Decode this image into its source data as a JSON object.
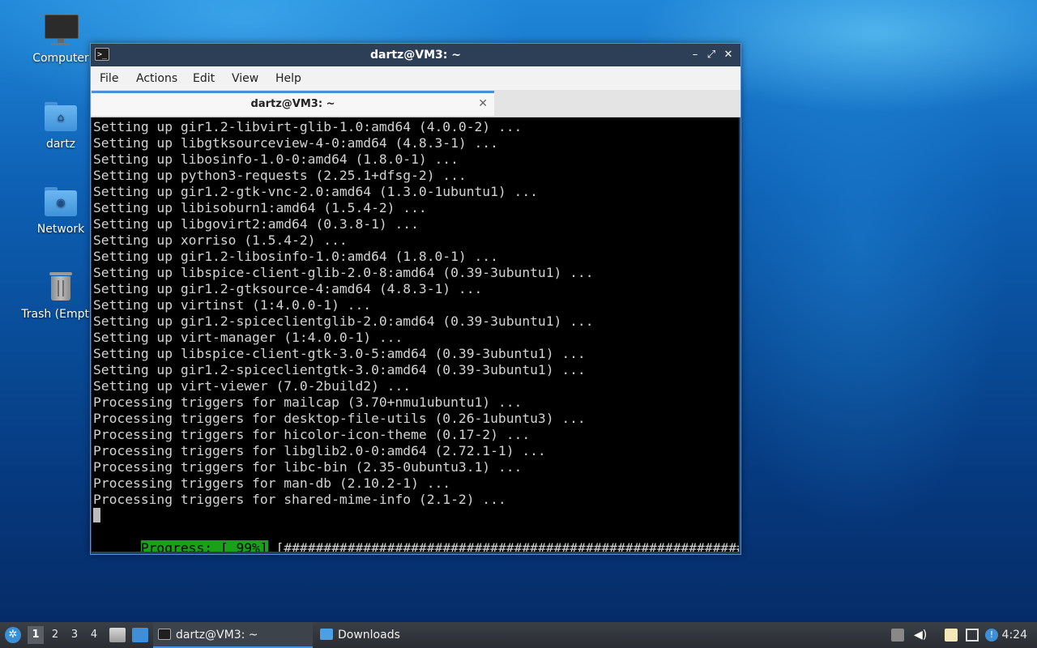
{
  "desktop": {
    "icons": [
      {
        "label": "Computer",
        "icon": "computer-icon"
      },
      {
        "label": "dartz",
        "icon": "home-folder-icon"
      },
      {
        "label": "Network",
        "icon": "network-folder-icon"
      },
      {
        "label": "Trash (Empty)",
        "icon": "trash-icon"
      }
    ]
  },
  "window": {
    "title": "dartz@VM3: ~",
    "controls": {
      "minimize": "–",
      "maximize": "⤢",
      "close": "✕"
    },
    "menu": [
      "File",
      "Actions",
      "Edit",
      "View",
      "Help"
    ],
    "tab": {
      "title": "dartz@VM3: ~",
      "close": "✕"
    }
  },
  "terminal": {
    "lines": [
      "Setting up gir1.2-libvirt-glib-1.0:amd64 (4.0.0-2) ...",
      "Setting up libgtksourceview-4-0:amd64 (4.8.3-1) ...",
      "Setting up libosinfo-1.0-0:amd64 (1.8.0-1) ...",
      "Setting up python3-requests (2.25.1+dfsg-2) ...",
      "Setting up gir1.2-gtk-vnc-2.0:amd64 (1.3.0-1ubuntu1) ...",
      "Setting up libisoburn1:amd64 (1.5.4-2) ...",
      "Setting up libgovirt2:amd64 (0.3.8-1) ...",
      "Setting up xorriso (1.5.4-2) ...",
      "Setting up gir1.2-libosinfo-1.0:amd64 (1.8.0-1) ...",
      "Setting up libspice-client-glib-2.0-8:amd64 (0.39-3ubuntu1) ...",
      "Setting up gir1.2-gtksource-4:amd64 (4.8.3-1) ...",
      "Setting up virtinst (1:4.0.0-1) ...",
      "Setting up gir1.2-spiceclientglib-2.0:amd64 (0.39-3ubuntu1) ...",
      "Setting up virt-manager (1:4.0.0-1) ...",
      "Setting up libspice-client-gtk-3.0-5:amd64 (0.39-3ubuntu1) ...",
      "Setting up gir1.2-spiceclientgtk-3.0:amd64 (0.39-3ubuntu1) ...",
      "Setting up virt-viewer (7.0-2build2) ...",
      "Processing triggers for mailcap (3.70+nmu1ubuntu1) ...",
      "Processing triggers for desktop-file-utils (0.26-1ubuntu3) ...",
      "Processing triggers for hicolor-icon-theme (0.17-2) ...",
      "Processing triggers for libglib2.0-0:amd64 (2.72.1-1) ...",
      "Processing triggers for libc-bin (2.35-0ubuntu3.1) ...",
      "Processing triggers for man-db (2.10.2-1) ...",
      "Processing triggers for shared-mime-info (2.1-2) ..."
    ],
    "progress": {
      "label": "Progress: [ 99%]",
      "percent": 99,
      "bar": "[##########################################################.]"
    }
  },
  "taskbar": {
    "workspaces": [
      "1",
      "2",
      "3",
      "4"
    ],
    "active_workspace": "1",
    "tasks": [
      {
        "label": "dartz@VM3: ~",
        "icon": "terminal-icon",
        "active": true
      },
      {
        "label": "Downloads",
        "icon": "folder-icon",
        "active": false
      }
    ],
    "tray": [
      "storage-icon",
      "volume-icon",
      "clipboard-icon",
      "network-icon",
      "notification-icon"
    ],
    "clock": "4:24"
  },
  "colors": {
    "accent": "#4a90d9",
    "progress_green": "#19a11b",
    "terminal_bg": "#000000",
    "terminal_fg": "#d3d3d3",
    "titlebar": "#2d3f56"
  }
}
